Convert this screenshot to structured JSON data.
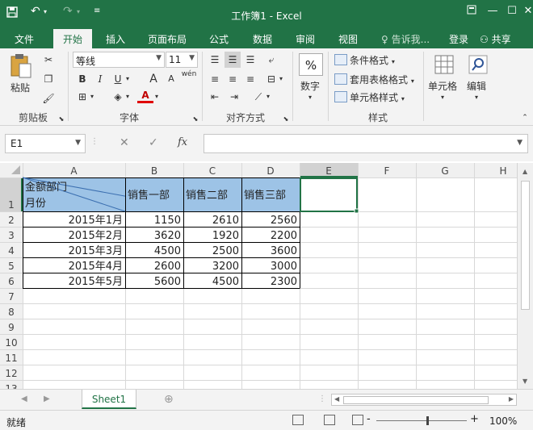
{
  "titlebar": {
    "title": "工作簿1 - Excel",
    "save_icon": "save-icon",
    "undo_icon": "undo-icon",
    "redo_icon": "redo-icon",
    "customize_icon": "customize-icon"
  },
  "tabs": [
    {
      "label": "文件"
    },
    {
      "label": "开始"
    },
    {
      "label": "插入"
    },
    {
      "label": "页面布局"
    },
    {
      "label": "公式"
    },
    {
      "label": "数据"
    },
    {
      "label": "审阅"
    },
    {
      "label": "视图"
    }
  ],
  "active_tab": "开始",
  "tell_me": "告诉我...",
  "login": "登录",
  "share": "共享",
  "ribbon": {
    "paste": "粘贴",
    "clipboard": "剪贴板",
    "font_name": "等线",
    "font_size": "11",
    "font_group": "字体",
    "align_group": "对齐方式",
    "number": "数字",
    "conditional_format": "条件格式",
    "table_format": "套用表格格式",
    "cell_style": "单元格样式",
    "style_group": "样式",
    "cells": "单元格",
    "editing": "编辑",
    "bold": "B",
    "italic": "I",
    "underline": "U",
    "grow_font": "A",
    "shrink_font": "A",
    "phonetic": "wén",
    "percent": "%"
  },
  "formula_bar": {
    "name_box": "E1",
    "fx": "fx",
    "value": ""
  },
  "sheet": {
    "columns": [
      "A",
      "B",
      "C",
      "D",
      "E",
      "F",
      "G",
      "H"
    ],
    "selected_column": "E",
    "rows": [
      "1",
      "2",
      "3",
      "4",
      "5",
      "6",
      "7",
      "8",
      "9",
      "10",
      "11",
      "12",
      "13"
    ],
    "header": {
      "a1_top": "金额部门",
      "a1_bottom": "月份",
      "b1": "销售一部",
      "c1": "销售二部",
      "d1": "销售三部"
    },
    "data": [
      [
        "2015年1月",
        "1150",
        "2610",
        "2560"
      ],
      [
        "2015年2月",
        "3620",
        "1920",
        "2200"
      ],
      [
        "2015年3月",
        "4500",
        "2500",
        "3600"
      ],
      [
        "2015年4月",
        "2600",
        "3200",
        "3000"
      ],
      [
        "2015年5月",
        "5600",
        "4500",
        "2300"
      ]
    ],
    "header_fill": "#9dc3e6",
    "selection_color": "#217346"
  },
  "sheet_tab": "Sheet1",
  "status": {
    "ready": "就绪",
    "zoom": "100%",
    "zoom_minus": "-",
    "zoom_plus": "+"
  }
}
